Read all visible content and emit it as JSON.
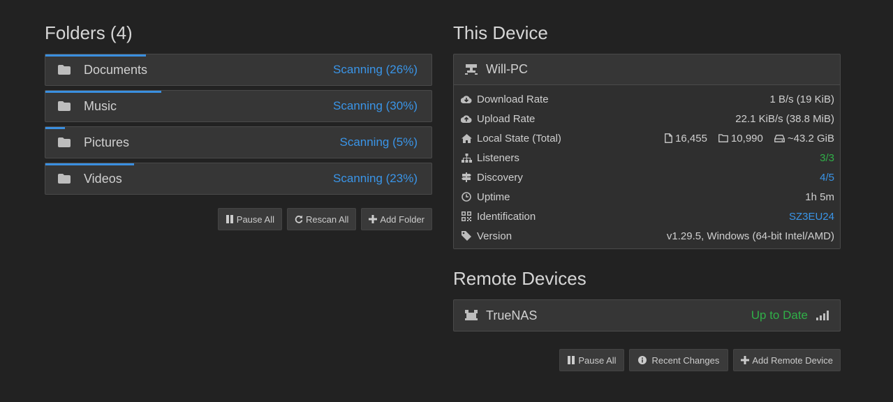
{
  "folders": {
    "title": "Folders (4)",
    "items": [
      {
        "name": "Documents",
        "status": "Scanning (26%)",
        "progress": 0.26
      },
      {
        "name": "Music",
        "status": "Scanning (30%)",
        "progress": 0.3
      },
      {
        "name": "Pictures",
        "status": "Scanning (5%)",
        "progress": 0.05
      },
      {
        "name": "Videos",
        "status": "Scanning (23%)",
        "progress": 0.23
      }
    ],
    "buttons": {
      "pause_all": "Pause All",
      "rescan_all": "Rescan All",
      "add_folder": "Add Folder"
    }
  },
  "this_device": {
    "title": "This Device",
    "name": "Will-PC",
    "stats": {
      "download_label": "Download Rate",
      "download_value": "1 B/s (19 KiB)",
      "upload_label": "Upload Rate",
      "upload_value": "22.1 KiB/s (38.8 MiB)",
      "local_state_label": "Local State (Total)",
      "files": "16,455",
      "dirs": "10,990",
      "size": "~43.2 GiB",
      "listeners_label": "Listeners",
      "listeners_value": "3/3",
      "discovery_label": "Discovery",
      "discovery_value": "4/5",
      "uptime_label": "Uptime",
      "uptime_value": "1h 5m",
      "identification_label": "Identification",
      "identification_value": "SZ3EU24",
      "version_label": "Version",
      "version_value": "v1.29.5, Windows (64-bit Intel/AMD)"
    }
  },
  "remote_devices": {
    "title": "Remote Devices",
    "items": [
      {
        "name": "TrueNAS",
        "status": "Up to Date"
      }
    ],
    "buttons": {
      "pause_all": "Pause All",
      "recent_changes": "Recent Changes",
      "add_remote": "Add Remote Device"
    }
  },
  "colors": {
    "accent": "#3a95e8",
    "ok": "#30b048",
    "background": "#222222",
    "panel": "#363636"
  }
}
